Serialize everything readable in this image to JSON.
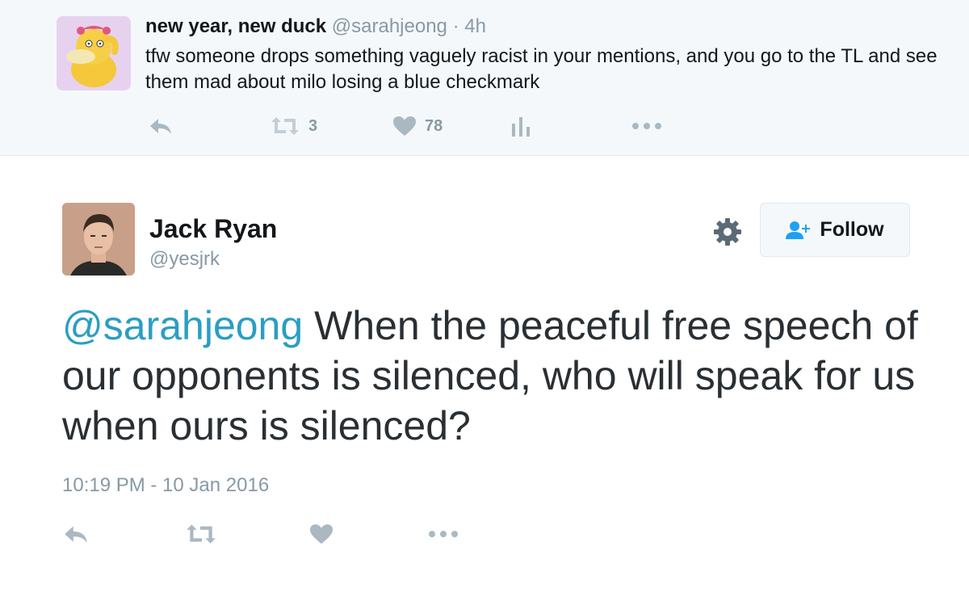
{
  "parent_tweet": {
    "display_name": "new year, new duck",
    "handle": "@sarahjeong",
    "separator": "·",
    "time": "4h",
    "text": "tfw someone drops something vaguely racist in your mentions, and you go to the TL and see them mad about milo losing a blue checkmark",
    "retweet_count": "3",
    "like_count": "78",
    "icons": [
      "reply-icon",
      "retweet-icon",
      "like-icon",
      "analytics-icon",
      "more-icon"
    ]
  },
  "main_tweet": {
    "display_name": "Jack Ryan",
    "handle": "@yesjrk",
    "follow_label": "Follow",
    "mention": "@sarahjeong",
    "text": " When the peaceful free speech of our opponents is silenced, who will speak for us when ours is silenced?",
    "timestamp": "10:19 PM - 10 Jan 2016",
    "icons": [
      "reply-icon",
      "retweet-icon",
      "like-icon",
      "more-icon"
    ]
  },
  "colors": {
    "link": "#2b9ec2",
    "muted": "#8899a6",
    "icon": "#aab8c2",
    "follow_icon": "#1da1f2"
  }
}
